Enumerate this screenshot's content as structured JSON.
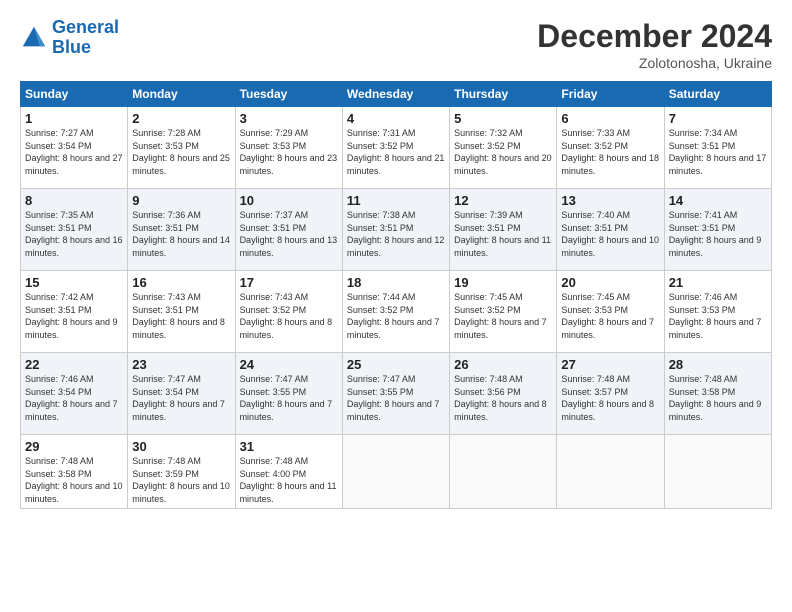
{
  "header": {
    "logo_line1": "General",
    "logo_line2": "Blue",
    "month": "December 2024",
    "location": "Zolotonosha, Ukraine"
  },
  "weekdays": [
    "Sunday",
    "Monday",
    "Tuesday",
    "Wednesday",
    "Thursday",
    "Friday",
    "Saturday"
  ],
  "weeks": [
    [
      {
        "day": "1",
        "rise": "7:27 AM",
        "set": "3:54 PM",
        "daylight": "8 hours and 27 minutes."
      },
      {
        "day": "2",
        "rise": "7:28 AM",
        "set": "3:53 PM",
        "daylight": "8 hours and 25 minutes."
      },
      {
        "day": "3",
        "rise": "7:29 AM",
        "set": "3:53 PM",
        "daylight": "8 hours and 23 minutes."
      },
      {
        "day": "4",
        "rise": "7:31 AM",
        "set": "3:52 PM",
        "daylight": "8 hours and 21 minutes."
      },
      {
        "day": "5",
        "rise": "7:32 AM",
        "set": "3:52 PM",
        "daylight": "8 hours and 20 minutes."
      },
      {
        "day": "6",
        "rise": "7:33 AM",
        "set": "3:52 PM",
        "daylight": "8 hours and 18 minutes."
      },
      {
        "day": "7",
        "rise": "7:34 AM",
        "set": "3:51 PM",
        "daylight": "8 hours and 17 minutes."
      }
    ],
    [
      {
        "day": "8",
        "rise": "7:35 AM",
        "set": "3:51 PM",
        "daylight": "8 hours and 16 minutes."
      },
      {
        "day": "9",
        "rise": "7:36 AM",
        "set": "3:51 PM",
        "daylight": "8 hours and 14 minutes."
      },
      {
        "day": "10",
        "rise": "7:37 AM",
        "set": "3:51 PM",
        "daylight": "8 hours and 13 minutes."
      },
      {
        "day": "11",
        "rise": "7:38 AM",
        "set": "3:51 PM",
        "daylight": "8 hours and 12 minutes."
      },
      {
        "day": "12",
        "rise": "7:39 AM",
        "set": "3:51 PM",
        "daylight": "8 hours and 11 minutes."
      },
      {
        "day": "13",
        "rise": "7:40 AM",
        "set": "3:51 PM",
        "daylight": "8 hours and 10 minutes."
      },
      {
        "day": "14",
        "rise": "7:41 AM",
        "set": "3:51 PM",
        "daylight": "8 hours and 9 minutes."
      }
    ],
    [
      {
        "day": "15",
        "rise": "7:42 AM",
        "set": "3:51 PM",
        "daylight": "8 hours and 9 minutes."
      },
      {
        "day": "16",
        "rise": "7:43 AM",
        "set": "3:51 PM",
        "daylight": "8 hours and 8 minutes."
      },
      {
        "day": "17",
        "rise": "7:43 AM",
        "set": "3:52 PM",
        "daylight": "8 hours and 8 minutes."
      },
      {
        "day": "18",
        "rise": "7:44 AM",
        "set": "3:52 PM",
        "daylight": "8 hours and 7 minutes."
      },
      {
        "day": "19",
        "rise": "7:45 AM",
        "set": "3:52 PM",
        "daylight": "8 hours and 7 minutes."
      },
      {
        "day": "20",
        "rise": "7:45 AM",
        "set": "3:53 PM",
        "daylight": "8 hours and 7 minutes."
      },
      {
        "day": "21",
        "rise": "7:46 AM",
        "set": "3:53 PM",
        "daylight": "8 hours and 7 minutes."
      }
    ],
    [
      {
        "day": "22",
        "rise": "7:46 AM",
        "set": "3:54 PM",
        "daylight": "8 hours and 7 minutes."
      },
      {
        "day": "23",
        "rise": "7:47 AM",
        "set": "3:54 PM",
        "daylight": "8 hours and 7 minutes."
      },
      {
        "day": "24",
        "rise": "7:47 AM",
        "set": "3:55 PM",
        "daylight": "8 hours and 7 minutes."
      },
      {
        "day": "25",
        "rise": "7:47 AM",
        "set": "3:55 PM",
        "daylight": "8 hours and 7 minutes."
      },
      {
        "day": "26",
        "rise": "7:48 AM",
        "set": "3:56 PM",
        "daylight": "8 hours and 8 minutes."
      },
      {
        "day": "27",
        "rise": "7:48 AM",
        "set": "3:57 PM",
        "daylight": "8 hours and 8 minutes."
      },
      {
        "day": "28",
        "rise": "7:48 AM",
        "set": "3:58 PM",
        "daylight": "8 hours and 9 minutes."
      }
    ],
    [
      {
        "day": "29",
        "rise": "7:48 AM",
        "set": "3:58 PM",
        "daylight": "8 hours and 10 minutes."
      },
      {
        "day": "30",
        "rise": "7:48 AM",
        "set": "3:59 PM",
        "daylight": "8 hours and 10 minutes."
      },
      {
        "day": "31",
        "rise": "7:48 AM",
        "set": "4:00 PM",
        "daylight": "8 hours and 11 minutes."
      },
      null,
      null,
      null,
      null
    ]
  ]
}
